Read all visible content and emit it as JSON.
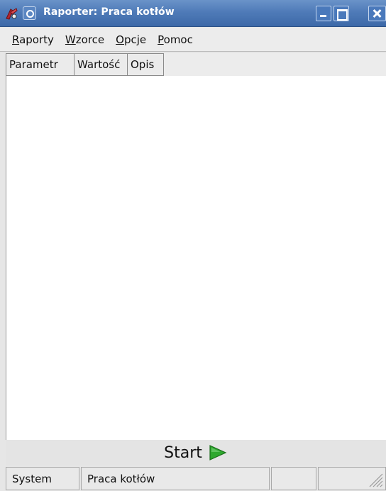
{
  "window": {
    "title": "Raporter: Praca kotłów"
  },
  "menubar": {
    "items": [
      {
        "mnemonic": "R",
        "rest": "aporty"
      },
      {
        "mnemonic": "W",
        "rest": "zorce"
      },
      {
        "mnemonic": "O",
        "rest": "pcje"
      },
      {
        "mnemonic": "P",
        "rest": "omoc"
      }
    ]
  },
  "table": {
    "columns": [
      "Parametr",
      "Wartość",
      "Opis"
    ]
  },
  "start": {
    "label": "Start",
    "icon": "play-icon",
    "icon_color": "#2ea82e"
  },
  "statusbar": {
    "cells": [
      "System",
      "Praca kotłów",
      "",
      ""
    ]
  },
  "colors": {
    "titlebar": "#4f7bb8",
    "accent_green": "#2ea82e"
  }
}
